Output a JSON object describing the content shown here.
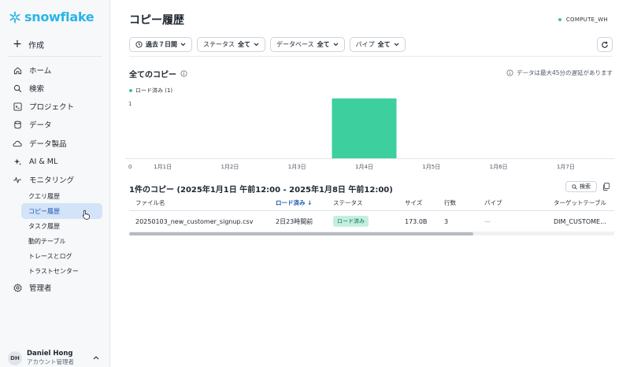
{
  "brand": {
    "logo_text": "snowflake",
    "color": "#29b5e8"
  },
  "sidebar": {
    "create_label": "作成",
    "items": [
      {
        "label": "ホーム",
        "icon": "home-icon"
      },
      {
        "label": "検索",
        "icon": "search-icon"
      },
      {
        "label": "プロジェクト",
        "icon": "code-icon"
      },
      {
        "label": "データ",
        "icon": "database-icon"
      },
      {
        "label": "データ製品",
        "icon": "cloud-icon"
      },
      {
        "label": "AI & ML",
        "icon": "sparkle-icon"
      },
      {
        "label": "モニタリング",
        "icon": "activity-icon"
      }
    ],
    "monitoring_sub": [
      {
        "label": "クエリ履歴",
        "active": false
      },
      {
        "label": "コピー履歴",
        "active": true
      },
      {
        "label": "タスク履歴",
        "active": false
      },
      {
        "label": "動的テーブル",
        "active": false
      },
      {
        "label": "トレースとログ",
        "active": false
      },
      {
        "label": "トラストセンター",
        "active": false
      }
    ],
    "admin_label": "管理者",
    "user": {
      "initials": "DH",
      "name": "Daniel Hong",
      "role": "アカウント管理者"
    }
  },
  "header": {
    "title": "コピー履歴",
    "warehouse": "COMPUTE_WH"
  },
  "filters": [
    {
      "prefix": "",
      "value": "過去７日間",
      "icon": "clock-icon"
    },
    {
      "prefix": "ステータス",
      "value": "全て"
    },
    {
      "prefix": "データベース",
      "value": "全て"
    },
    {
      "prefix": "パイプ",
      "value": "全て"
    }
  ],
  "chart_section": {
    "title": "全てのコピー",
    "delay_note": "データは最大45分の遅延があります",
    "legend_label": "ロード済み (1)"
  },
  "chart_data": {
    "type": "bar",
    "categories": [
      "1月1日",
      "1月2日",
      "1月3日",
      "1月4日",
      "1月5日",
      "1月6日",
      "1月7日"
    ],
    "series": [
      {
        "name": "ロード済み",
        "values": [
          0,
          0,
          0,
          1,
          0,
          0,
          0
        ]
      }
    ],
    "ylim": [
      0,
      1
    ],
    "yticks": [
      "0",
      "1"
    ],
    "color": "#3ecf9e",
    "grid": false
  },
  "copies": {
    "title": "1件のコピー (2025年1月1日 午前12:00 - 2025年1月8日 午前12:00)",
    "search_label": "検索",
    "columns": [
      "ファイル名",
      "ロード済み ↓",
      "ステータス",
      "サイズ",
      "行数",
      "パイプ",
      "ターゲットテーブル"
    ],
    "rows": [
      {
        "file": "20250103_new_customer_signup.csv",
        "loaded": "2日23時間前",
        "status": "ロード済み",
        "size": "173.0B",
        "rows": "3",
        "pipe": "—",
        "target": "DIM_CUSTOME..."
      }
    ]
  }
}
